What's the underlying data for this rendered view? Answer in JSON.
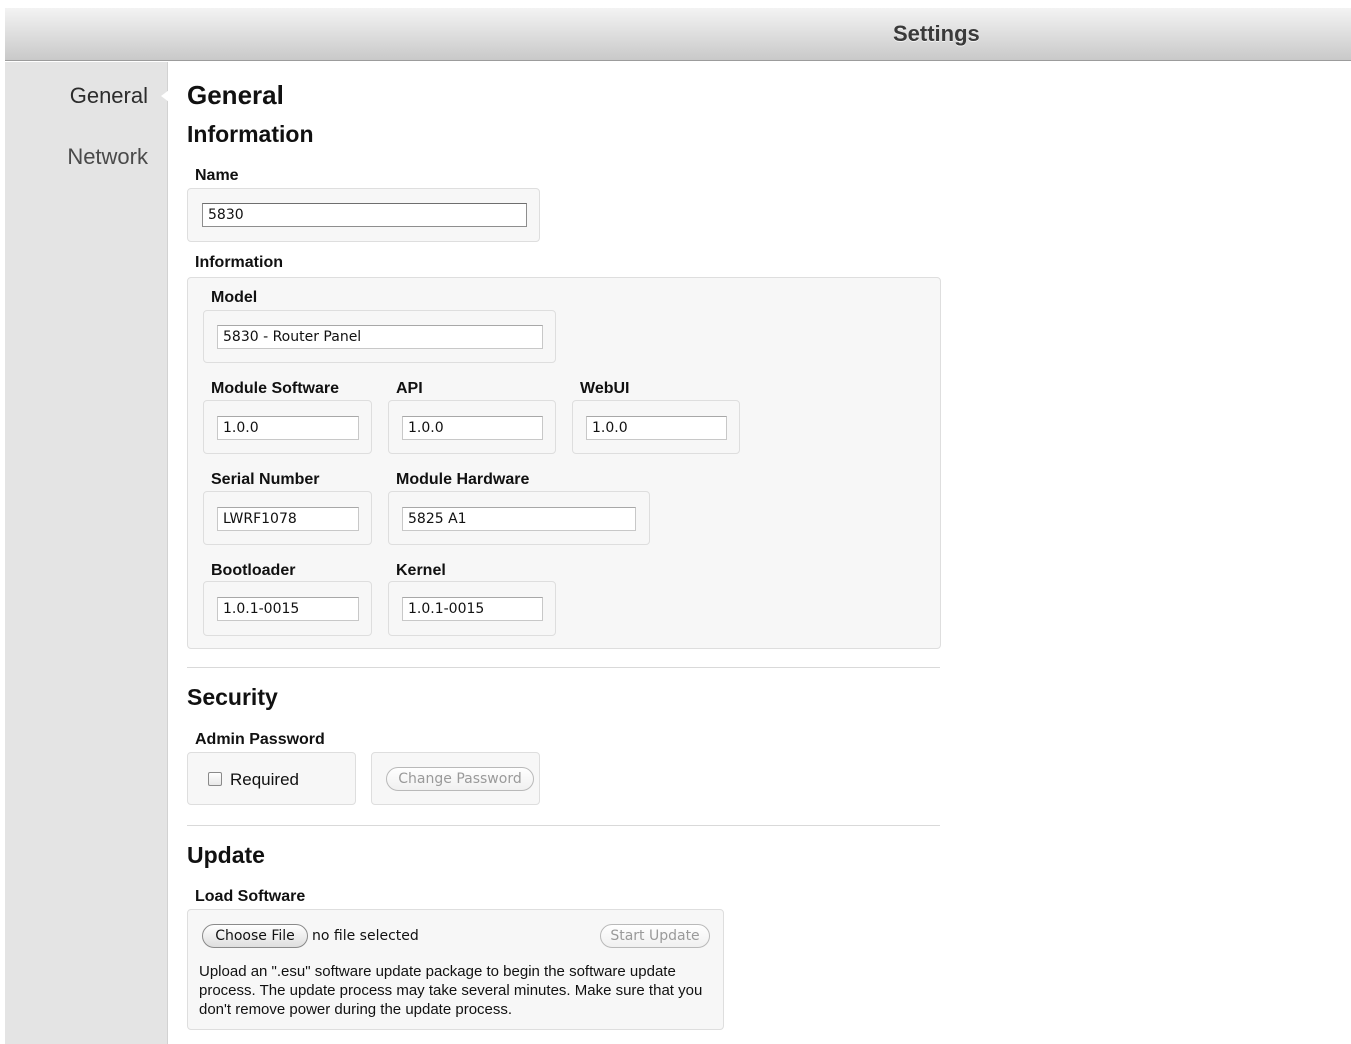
{
  "window": {
    "title": "Settings"
  },
  "sidebar": {
    "items": [
      {
        "label": "General",
        "selected": true
      },
      {
        "label": "Network",
        "selected": false
      }
    ]
  },
  "page": {
    "title": "General"
  },
  "information_section": {
    "heading": "Information",
    "name_label": "Name",
    "name_value": "5830",
    "info_group_label": "Information",
    "model_label": "Model",
    "model_value": "5830 - Router Panel",
    "module_software_label": "Module Software",
    "module_software_value": "1.0.0",
    "api_label": "API",
    "api_value": "1.0.0",
    "webui_label": "WebUI",
    "webui_value": "1.0.0",
    "serial_label": "Serial Number",
    "serial_value": "LWRF1078",
    "module_hardware_label": "Module Hardware",
    "module_hardware_value": "5825 A1",
    "bootloader_label": "Bootloader",
    "bootloader_value": "1.0.1-0015",
    "kernel_label": "Kernel",
    "kernel_value": "1.0.1-0015"
  },
  "security_section": {
    "heading": "Security",
    "admin_password_label": "Admin Password",
    "required_label": "Required",
    "required_checked": false,
    "change_password_label": "Change Password"
  },
  "update_section": {
    "heading": "Update",
    "load_software_label": "Load Software",
    "choose_file_label": "Choose File",
    "no_file_text": "no file selected",
    "start_update_label": "Start Update",
    "help_text": "Upload an \".esu\" software update package to begin the software update process. The update process may take several minutes. Make sure that you don't remove power during the update process."
  }
}
